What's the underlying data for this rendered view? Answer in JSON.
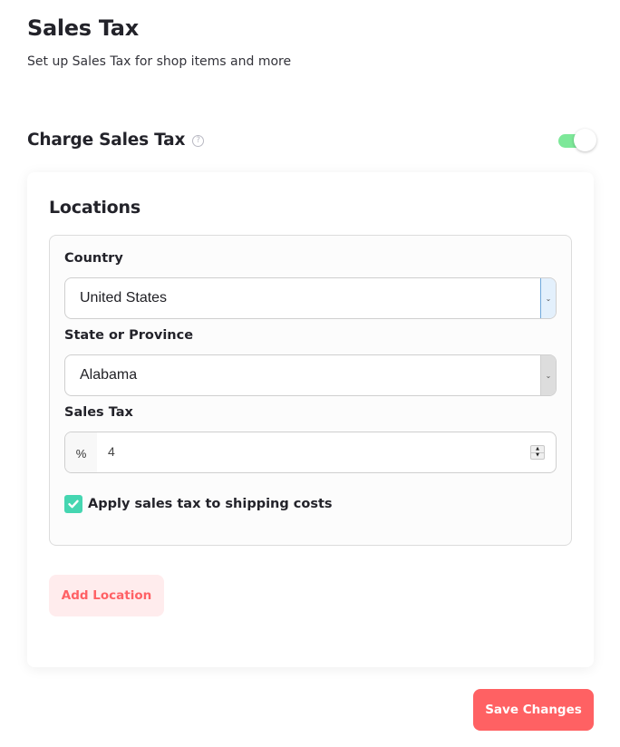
{
  "header": {
    "title": "Sales Tax",
    "subtitle": "Set up Sales Tax for shop items and more"
  },
  "charge_sales_tax": {
    "label": "Charge Sales Tax",
    "help_icon": "question-circle-icon",
    "help_glyph": "?",
    "enabled": true,
    "toggle_color": "#7de899"
  },
  "locations": {
    "title": "Locations",
    "items": [
      {
        "country": {
          "label": "Country",
          "value": "United States",
          "arrow_glyph": "⌄"
        },
        "state": {
          "label": "State or Province",
          "value": "Alabama",
          "arrow_glyph": "⌄"
        },
        "sales_tax": {
          "label": "Sales Tax",
          "prefix": "%",
          "value": "4",
          "spinner_up": "▲",
          "spinner_down": "▼"
        },
        "apply_to_shipping": {
          "label": "Apply sales tax to shipping costs",
          "checked": true,
          "color": "#45d6b1"
        }
      }
    ],
    "add_button_label": "Add Location"
  },
  "footer": {
    "save_button_label": "Save Changes",
    "accent_color": "#ff6163"
  }
}
